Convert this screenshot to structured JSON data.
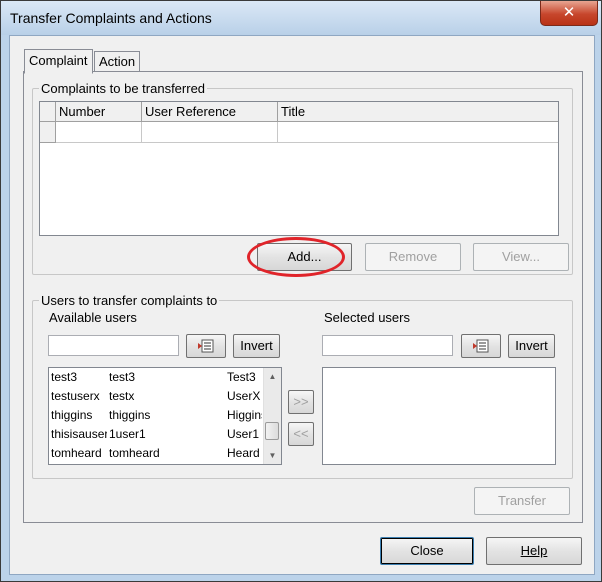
{
  "window": {
    "title": "Transfer Complaints and Actions",
    "close_glyph": "✕"
  },
  "tabs": [
    {
      "label": "Complaint",
      "active": true
    },
    {
      "label": "Action",
      "active": false
    }
  ],
  "complaints": {
    "legend": "Complaints to be transferred",
    "columns": [
      "Number",
      "User Reference",
      "Title"
    ],
    "buttons": {
      "add": "Add...",
      "remove": "Remove",
      "view": "View..."
    }
  },
  "users": {
    "legend": "Users to transfer complaints to",
    "available_label": "Available users",
    "selected_label": "Selected users",
    "available_search_value": "",
    "selected_search_value": "",
    "invert_label": "Invert",
    "filter_icon": "filter-icon",
    "move_right": ">>",
    "move_left": "<<",
    "available_rows": [
      {
        "id": "test3",
        "name": "test3",
        "desc": "Test3"
      },
      {
        "id": "testuserx",
        "name": "testx",
        "desc": "UserX"
      },
      {
        "id": "thiggins",
        "name": "thiggins",
        "desc": "Higgins"
      },
      {
        "id": "thisisauser",
        "name": "1user1",
        "desc": "User1"
      },
      {
        "id": "tomheard",
        "name": "tomheard",
        "desc": "Heard"
      }
    ],
    "selected_rows": []
  },
  "footer": {
    "transfer": "Transfer",
    "close": "Close",
    "help": "Help"
  },
  "colors": {
    "annotation": "#e0242a",
    "title_bar": "#bcd3ea",
    "close_button": "#c7462c"
  }
}
